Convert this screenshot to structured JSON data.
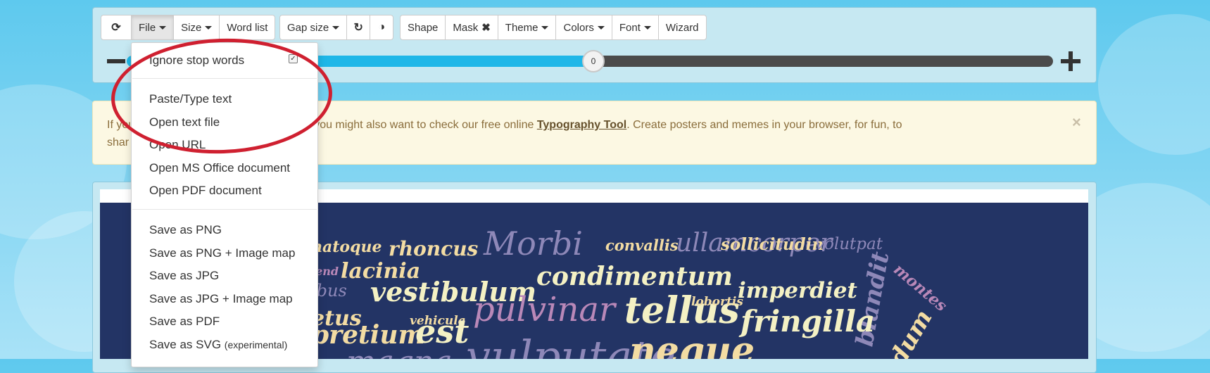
{
  "toolbar": {
    "refresh_icon": "refresh-icon",
    "file_label": "File",
    "size_label": "Size",
    "word_list_label": "Word list",
    "gap_size_label": "Gap size",
    "redo_icon": "redo-icon",
    "contrast_icon": "contrast-icon",
    "shape_label": "Shape",
    "mask_label": "Mask",
    "mask_clear_icon": "close-icon",
    "theme_label": "Theme",
    "colors_label": "Colors",
    "font_label": "Font",
    "wizard_label": "Wizard"
  },
  "slider": {
    "value_label": "0",
    "level_fraction": 0.5
  },
  "alert": {
    "text_prefix": "If you",
    "text_middle": "a you do!), you might also want to check our free online ",
    "link_text": "Typography Tool",
    "text_suffix": ". Create posters and memes in your browser, for fun, to",
    "text_line2": "shar"
  },
  "file_menu": {
    "ignore_stop_words": "Ignore stop words",
    "ignore_stop_words_checked": true,
    "paste_type_text": "Paste/Type text",
    "open_text_file": "Open text file",
    "open_url": "Open URL",
    "open_ms_office": "Open MS Office document",
    "open_pdf": "Open PDF document",
    "save_png": "Save as PNG",
    "save_png_map": "Save as PNG + Image map",
    "save_jpg": "Save as JPG",
    "save_jpg_map": "Save as JPG + Image map",
    "save_pdf": "Save as PDF",
    "save_svg": "Save as SVG",
    "save_svg_note": "(experimental)"
  },
  "word_cloud": {
    "words": [
      {
        "text": "natoque",
        "color": "#f3dca3"
      },
      {
        "text": "rhoncus",
        "color": "#f3dca3"
      },
      {
        "text": "Morbi",
        "color": "#8e88b8"
      },
      {
        "text": "convallis",
        "color": "#f3dca3"
      },
      {
        "text": "ullamcorper",
        "color": "#8e88b8"
      },
      {
        "text": "sollicitudin",
        "color": "#f3dca3"
      },
      {
        "text": "volutpat",
        "color": "#8e88b8"
      },
      {
        "text": "lacinia",
        "color": "#f3dca3"
      },
      {
        "text": "vestibulum",
        "color": "#f4f1c4"
      },
      {
        "text": "condimentum",
        "color": "#f4f1c4"
      },
      {
        "text": "imperdiet",
        "color": "#f4f1c4"
      },
      {
        "text": "blandit",
        "color": "#8e88b8"
      },
      {
        "text": "montes",
        "color": "#b988b8"
      },
      {
        "text": "pulvinar",
        "color": "#b988b8"
      },
      {
        "text": "tellus",
        "color": "#f4f1c4"
      },
      {
        "text": "lobortis",
        "color": "#f3dca3"
      },
      {
        "text": "fringilla",
        "color": "#f4f1c4"
      },
      {
        "text": "vehicula",
        "color": "#f3dca3"
      },
      {
        "text": "pretium",
        "color": "#f3dca3"
      },
      {
        "text": "est",
        "color": "#f4f1c4"
      },
      {
        "text": "vulputate",
        "color": "#8e88b8"
      },
      {
        "text": "neque",
        "color": "#f3dca3"
      },
      {
        "text": "etus",
        "color": "#f3dca3"
      },
      {
        "text": "ibus",
        "color": "#8e88b8"
      },
      {
        "text": "lend",
        "color": "#b988b8"
      },
      {
        "text": "dum",
        "color": "#f3dca3"
      },
      {
        "text": "magna",
        "color": "#8e88b8"
      }
    ]
  }
}
